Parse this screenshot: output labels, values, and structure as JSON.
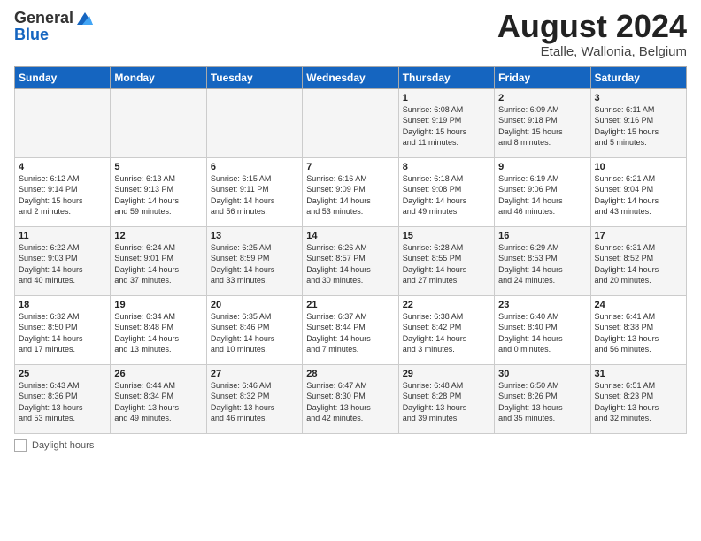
{
  "logo": {
    "general": "General",
    "blue": "Blue"
  },
  "title": "August 2024",
  "subtitle": "Etalle, Wallonia, Belgium",
  "days_of_week": [
    "Sunday",
    "Monday",
    "Tuesday",
    "Wednesday",
    "Thursday",
    "Friday",
    "Saturday"
  ],
  "footer_label": "Daylight hours",
  "weeks": [
    [
      {
        "day": "",
        "info": ""
      },
      {
        "day": "",
        "info": ""
      },
      {
        "day": "",
        "info": ""
      },
      {
        "day": "",
        "info": ""
      },
      {
        "day": "1",
        "info": "Sunrise: 6:08 AM\nSunset: 9:19 PM\nDaylight: 15 hours\nand 11 minutes."
      },
      {
        "day": "2",
        "info": "Sunrise: 6:09 AM\nSunset: 9:18 PM\nDaylight: 15 hours\nand 8 minutes."
      },
      {
        "day": "3",
        "info": "Sunrise: 6:11 AM\nSunset: 9:16 PM\nDaylight: 15 hours\nand 5 minutes."
      }
    ],
    [
      {
        "day": "4",
        "info": "Sunrise: 6:12 AM\nSunset: 9:14 PM\nDaylight: 15 hours\nand 2 minutes."
      },
      {
        "day": "5",
        "info": "Sunrise: 6:13 AM\nSunset: 9:13 PM\nDaylight: 14 hours\nand 59 minutes."
      },
      {
        "day": "6",
        "info": "Sunrise: 6:15 AM\nSunset: 9:11 PM\nDaylight: 14 hours\nand 56 minutes."
      },
      {
        "day": "7",
        "info": "Sunrise: 6:16 AM\nSunset: 9:09 PM\nDaylight: 14 hours\nand 53 minutes."
      },
      {
        "day": "8",
        "info": "Sunrise: 6:18 AM\nSunset: 9:08 PM\nDaylight: 14 hours\nand 49 minutes."
      },
      {
        "day": "9",
        "info": "Sunrise: 6:19 AM\nSunset: 9:06 PM\nDaylight: 14 hours\nand 46 minutes."
      },
      {
        "day": "10",
        "info": "Sunrise: 6:21 AM\nSunset: 9:04 PM\nDaylight: 14 hours\nand 43 minutes."
      }
    ],
    [
      {
        "day": "11",
        "info": "Sunrise: 6:22 AM\nSunset: 9:03 PM\nDaylight: 14 hours\nand 40 minutes."
      },
      {
        "day": "12",
        "info": "Sunrise: 6:24 AM\nSunset: 9:01 PM\nDaylight: 14 hours\nand 37 minutes."
      },
      {
        "day": "13",
        "info": "Sunrise: 6:25 AM\nSunset: 8:59 PM\nDaylight: 14 hours\nand 33 minutes."
      },
      {
        "day": "14",
        "info": "Sunrise: 6:26 AM\nSunset: 8:57 PM\nDaylight: 14 hours\nand 30 minutes."
      },
      {
        "day": "15",
        "info": "Sunrise: 6:28 AM\nSunset: 8:55 PM\nDaylight: 14 hours\nand 27 minutes."
      },
      {
        "day": "16",
        "info": "Sunrise: 6:29 AM\nSunset: 8:53 PM\nDaylight: 14 hours\nand 24 minutes."
      },
      {
        "day": "17",
        "info": "Sunrise: 6:31 AM\nSunset: 8:52 PM\nDaylight: 14 hours\nand 20 minutes."
      }
    ],
    [
      {
        "day": "18",
        "info": "Sunrise: 6:32 AM\nSunset: 8:50 PM\nDaylight: 14 hours\nand 17 minutes."
      },
      {
        "day": "19",
        "info": "Sunrise: 6:34 AM\nSunset: 8:48 PM\nDaylight: 14 hours\nand 13 minutes."
      },
      {
        "day": "20",
        "info": "Sunrise: 6:35 AM\nSunset: 8:46 PM\nDaylight: 14 hours\nand 10 minutes."
      },
      {
        "day": "21",
        "info": "Sunrise: 6:37 AM\nSunset: 8:44 PM\nDaylight: 14 hours\nand 7 minutes."
      },
      {
        "day": "22",
        "info": "Sunrise: 6:38 AM\nSunset: 8:42 PM\nDaylight: 14 hours\nand 3 minutes."
      },
      {
        "day": "23",
        "info": "Sunrise: 6:40 AM\nSunset: 8:40 PM\nDaylight: 14 hours\nand 0 minutes."
      },
      {
        "day": "24",
        "info": "Sunrise: 6:41 AM\nSunset: 8:38 PM\nDaylight: 13 hours\nand 56 minutes."
      }
    ],
    [
      {
        "day": "25",
        "info": "Sunrise: 6:43 AM\nSunset: 8:36 PM\nDaylight: 13 hours\nand 53 minutes."
      },
      {
        "day": "26",
        "info": "Sunrise: 6:44 AM\nSunset: 8:34 PM\nDaylight: 13 hours\nand 49 minutes."
      },
      {
        "day": "27",
        "info": "Sunrise: 6:46 AM\nSunset: 8:32 PM\nDaylight: 13 hours\nand 46 minutes."
      },
      {
        "day": "28",
        "info": "Sunrise: 6:47 AM\nSunset: 8:30 PM\nDaylight: 13 hours\nand 42 minutes."
      },
      {
        "day": "29",
        "info": "Sunrise: 6:48 AM\nSunset: 8:28 PM\nDaylight: 13 hours\nand 39 minutes."
      },
      {
        "day": "30",
        "info": "Sunrise: 6:50 AM\nSunset: 8:26 PM\nDaylight: 13 hours\nand 35 minutes."
      },
      {
        "day": "31",
        "info": "Sunrise: 6:51 AM\nSunset: 8:23 PM\nDaylight: 13 hours\nand 32 minutes."
      }
    ]
  ]
}
